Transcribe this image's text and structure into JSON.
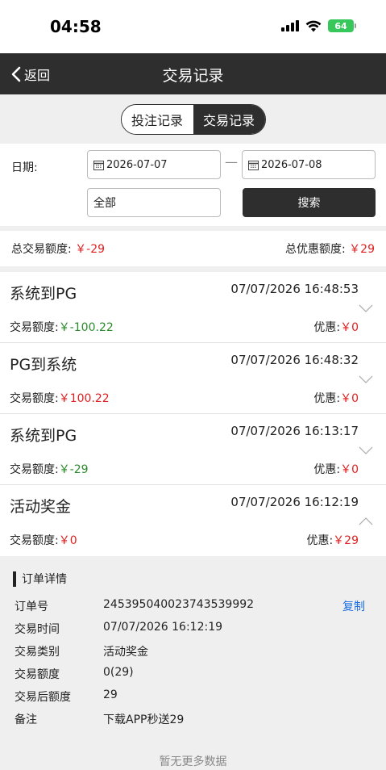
{
  "status": {
    "time": "04:58",
    "battery": "64"
  },
  "nav": {
    "back_label": "返回",
    "title": "交易记录"
  },
  "tabs": [
    {
      "label": "投注记录"
    },
    {
      "label": "交易记录"
    }
  ],
  "filter": {
    "date_label": "日期:",
    "start_date": "2026-07-07",
    "separator": "—",
    "end_date": "2026-07-08",
    "type_value": "全部",
    "search_label": "搜索"
  },
  "summary": {
    "total_label": "总交易额度:",
    "total_value": "￥-29",
    "discount_label": "总优惠额度:",
    "discount_value": "￥29"
  },
  "records": [
    {
      "title": "系统到PG",
      "time": "07/07/2026 16:48:53",
      "amount_label": "交易额度:",
      "amount": "￥-100.22",
      "discount_label": "优惠:",
      "discount": "￥0"
    },
    {
      "title": "PG到系统",
      "time": "07/07/2026 16:48:32",
      "amount_label": "交易额度:",
      "amount": "￥100.22",
      "discount_label": "优惠:",
      "discount": "￥0"
    },
    {
      "title": "系统到PG",
      "time": "07/07/2026 16:13:17",
      "amount_label": "交易额度:",
      "amount": "￥-29",
      "discount_label": "优惠:",
      "discount": "￥0"
    },
    {
      "title": "活动奖金",
      "time": "07/07/2026 16:12:19",
      "amount_label": "交易额度:",
      "amount": "￥0",
      "discount_label": "优惠:",
      "discount": "￥29"
    }
  ],
  "detail": {
    "header": "订单详情",
    "copy_label": "复制",
    "rows": [
      {
        "key": "订单号",
        "value": "245395040023743539992"
      },
      {
        "key": "交易时间",
        "value": "07/07/2026 16:12:19"
      },
      {
        "key": "交易类别",
        "value": "活动奖金"
      },
      {
        "key": "交易额度",
        "value": "0(29)"
      },
      {
        "key": "交易后额度",
        "value": "29"
      },
      {
        "key": "备注",
        "value": "下载APP秒送29"
      }
    ]
  },
  "footer": {
    "no_more": "暂无更多数据"
  },
  "colors": {
    "accent_dark": "#2e2e2e",
    "negative_red": "#e02020",
    "positive_green": "#2a8c2a",
    "link_blue": "#1a6fe0",
    "battery_green": "#38c75b"
  }
}
